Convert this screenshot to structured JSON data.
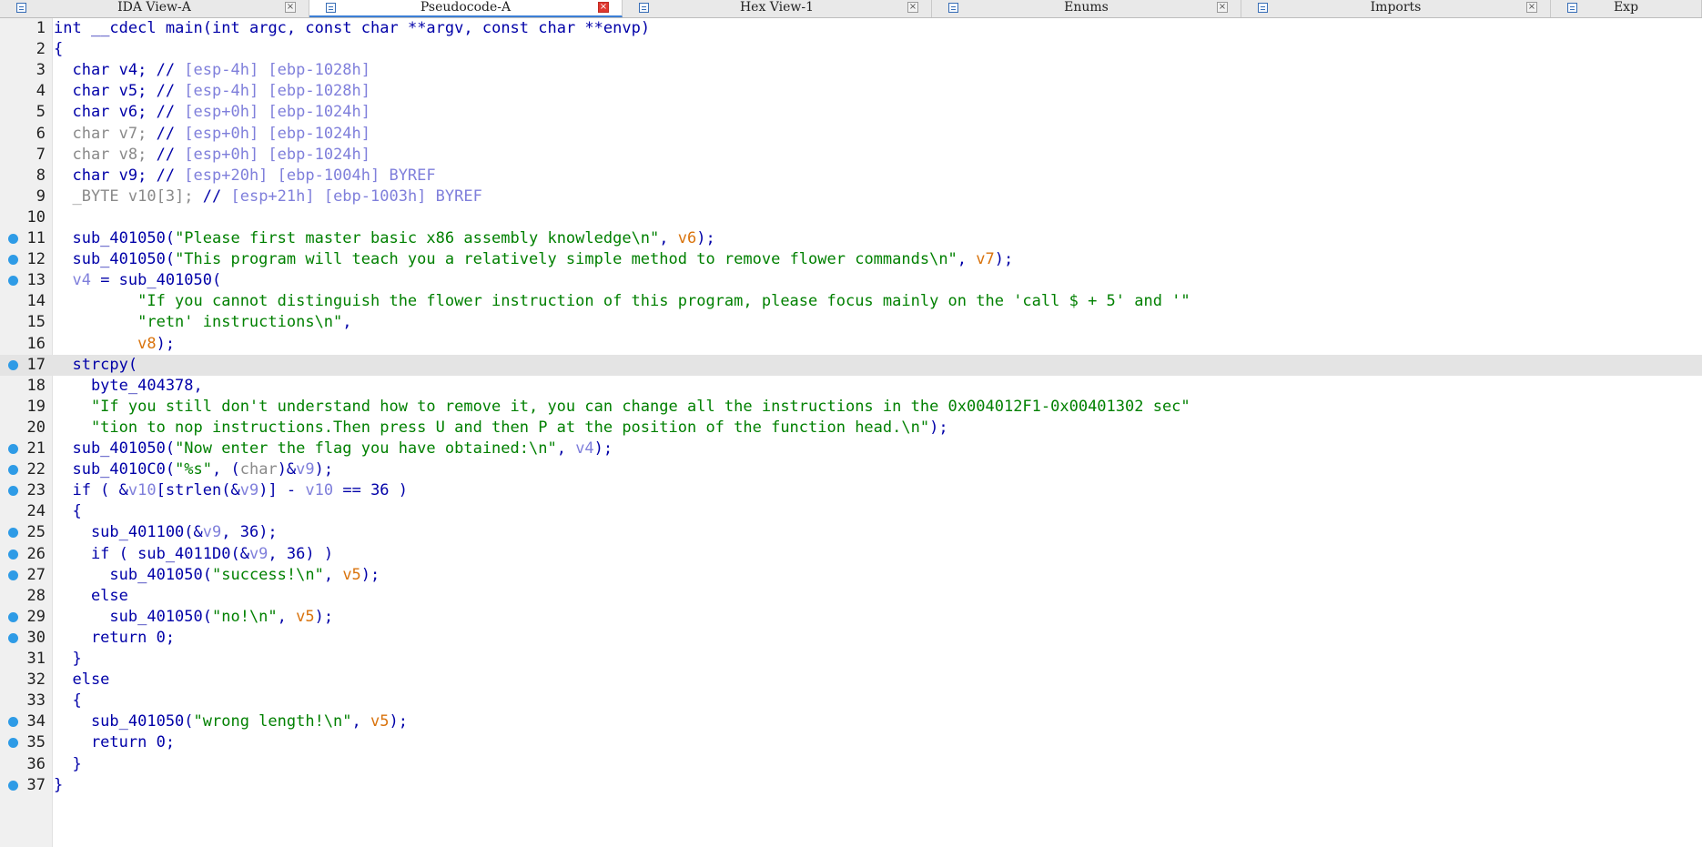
{
  "tabs": [
    {
      "label": "IDA View-A",
      "width": 340,
      "active": false,
      "close": "×"
    },
    {
      "label": "Pseudocode-A",
      "width": 344,
      "active": true,
      "close": "×"
    },
    {
      "label": "Hex View-1",
      "width": 340,
      "active": false,
      "close": "×"
    },
    {
      "label": "Enums",
      "width": 340,
      "active": false,
      "close": "×"
    },
    {
      "label": "Imports",
      "width": 340,
      "active": false,
      "close": "×"
    },
    {
      "label": "Exp",
      "width": 166,
      "active": false,
      "close": ""
    }
  ],
  "code": [
    {
      "n": "1",
      "bp": false,
      "hl": false,
      "segs": [
        [
          "kw",
          "int "
        ],
        [
          "kw",
          "__cdecl "
        ],
        [
          "fn",
          "main"
        ],
        [
          "kw",
          "(int argc, const char **argv, const char **envp)"
        ]
      ]
    },
    {
      "n": "2",
      "bp": false,
      "hl": false,
      "segs": [
        [
          "kw",
          "{"
        ]
      ]
    },
    {
      "n": "3",
      "bp": false,
      "hl": false,
      "segs": [
        [
          "kw",
          "  char v4; // "
        ],
        [
          "cm",
          "[esp-4h] [ebp-1028h]"
        ]
      ]
    },
    {
      "n": "4",
      "bp": false,
      "hl": false,
      "segs": [
        [
          "kw",
          "  char v5; // "
        ],
        [
          "cm",
          "[esp-4h] [ebp-1028h]"
        ]
      ]
    },
    {
      "n": "5",
      "bp": false,
      "hl": false,
      "segs": [
        [
          "kw",
          "  char v6; // "
        ],
        [
          "cm",
          "[esp+0h] [ebp-1024h]"
        ]
      ]
    },
    {
      "n": "6",
      "bp": false,
      "hl": false,
      "segs": [
        [
          "unk",
          "  char v7; "
        ],
        [
          "kw",
          "// "
        ],
        [
          "cm",
          "[esp+0h] [ebp-1024h]"
        ]
      ]
    },
    {
      "n": "7",
      "bp": false,
      "hl": false,
      "segs": [
        [
          "unk",
          "  char v8; "
        ],
        [
          "kw",
          "// "
        ],
        [
          "cm",
          "[esp+0h] [ebp-1024h]"
        ]
      ]
    },
    {
      "n": "8",
      "bp": false,
      "hl": false,
      "segs": [
        [
          "kw",
          "  char v9; // "
        ],
        [
          "cm",
          "[esp+20h] [ebp-1004h] BYREF"
        ]
      ]
    },
    {
      "n": "9",
      "bp": false,
      "hl": false,
      "segs": [
        [
          "unk",
          "  _BYTE v10[3]; "
        ],
        [
          "kw",
          "// "
        ],
        [
          "cm",
          "[esp+21h] [ebp-1003h] BYREF"
        ]
      ]
    },
    {
      "n": "10",
      "bp": false,
      "hl": false,
      "segs": []
    },
    {
      "n": "11",
      "bp": true,
      "hl": false,
      "segs": [
        [
          "kw",
          "  sub_401050("
        ],
        [
          "str",
          "\"Please first master basic x86 assembly knowledge\\n\""
        ],
        [
          "kw",
          ", "
        ],
        [
          "arg",
          "v6"
        ],
        [
          "kw",
          ");"
        ]
      ]
    },
    {
      "n": "12",
      "bp": true,
      "hl": false,
      "segs": [
        [
          "kw",
          "  sub_401050("
        ],
        [
          "str",
          "\"This program will teach you a relatively simple method to remove flower commands\\n\""
        ],
        [
          "kw",
          ", "
        ],
        [
          "arg",
          "v7"
        ],
        [
          "kw",
          ");"
        ]
      ]
    },
    {
      "n": "13",
      "bp": true,
      "hl": false,
      "segs": [
        [
          "var",
          "  v4"
        ],
        [
          "kw",
          " = sub_401050("
        ]
      ]
    },
    {
      "n": "14",
      "bp": false,
      "hl": false,
      "segs": [
        [
          "str",
          "         \"If you cannot distinguish the flower instruction of this program, please focus mainly on the 'call $ + 5' and '\""
        ]
      ]
    },
    {
      "n": "15",
      "bp": false,
      "hl": false,
      "segs": [
        [
          "str",
          "         \"retn' instructions\\n\""
        ],
        [
          "kw",
          ","
        ]
      ]
    },
    {
      "n": "16",
      "bp": false,
      "hl": false,
      "segs": [
        [
          "arg",
          "         v8"
        ],
        [
          "kw",
          ");"
        ]
      ]
    },
    {
      "n": "17",
      "bp": true,
      "hl": true,
      "segs": [
        [
          "kw",
          "  strcpy("
        ]
      ]
    },
    {
      "n": "18",
      "bp": false,
      "hl": false,
      "segs": [
        [
          "kw",
          "    byte_404378,"
        ]
      ]
    },
    {
      "n": "19",
      "bp": false,
      "hl": false,
      "segs": [
        [
          "str",
          "    \"If you still don't understand how to remove it, you can change all the instructions in the 0x004012F1-0x00401302 sec\""
        ]
      ]
    },
    {
      "n": "20",
      "bp": false,
      "hl": false,
      "segs": [
        [
          "str",
          "    \"tion to nop instructions.Then press U and then P at the position of the function head.\\n\""
        ],
        [
          "kw",
          ");"
        ]
      ]
    },
    {
      "n": "21",
      "bp": true,
      "hl": false,
      "segs": [
        [
          "kw",
          "  sub_401050("
        ],
        [
          "str",
          "\"Now enter the flag you have obtained:\\n\""
        ],
        [
          "kw",
          ", "
        ],
        [
          "var",
          "v4"
        ],
        [
          "kw",
          ");"
        ]
      ]
    },
    {
      "n": "22",
      "bp": true,
      "hl": false,
      "segs": [
        [
          "kw",
          "  sub_4010C0("
        ],
        [
          "str",
          "\"%s\""
        ],
        [
          "kw",
          ", ("
        ],
        [
          "unk",
          "char"
        ],
        [
          "kw",
          ")&"
        ],
        [
          "var",
          "v9"
        ],
        [
          "kw",
          ");"
        ]
      ]
    },
    {
      "n": "23",
      "bp": true,
      "hl": false,
      "segs": [
        [
          "kw",
          "  if ( &"
        ],
        [
          "var",
          "v10"
        ],
        [
          "kw",
          "[strlen(&"
        ],
        [
          "var",
          "v9"
        ],
        [
          "kw",
          ")] - "
        ],
        [
          "var",
          "v10"
        ],
        [
          "kw",
          " == 36 )"
        ]
      ]
    },
    {
      "n": "24",
      "bp": false,
      "hl": false,
      "segs": [
        [
          "kw",
          "  {"
        ]
      ]
    },
    {
      "n": "25",
      "bp": true,
      "hl": false,
      "segs": [
        [
          "kw",
          "    sub_401100(&"
        ],
        [
          "var",
          "v9"
        ],
        [
          "kw",
          ", 36);"
        ]
      ]
    },
    {
      "n": "26",
      "bp": true,
      "hl": false,
      "segs": [
        [
          "kw",
          "    if ( sub_4011D0(&"
        ],
        [
          "var",
          "v9"
        ],
        [
          "kw",
          ", 36) )"
        ]
      ]
    },
    {
      "n": "27",
      "bp": true,
      "hl": false,
      "segs": [
        [
          "kw",
          "      sub_401050("
        ],
        [
          "str",
          "\"success!\\n\""
        ],
        [
          "kw",
          ", "
        ],
        [
          "arg",
          "v5"
        ],
        [
          "kw",
          ");"
        ]
      ]
    },
    {
      "n": "28",
      "bp": false,
      "hl": false,
      "segs": [
        [
          "kw",
          "    else"
        ]
      ]
    },
    {
      "n": "29",
      "bp": true,
      "hl": false,
      "segs": [
        [
          "kw",
          "      sub_401050("
        ],
        [
          "str",
          "\"no!\\n\""
        ],
        [
          "kw",
          ", "
        ],
        [
          "arg",
          "v5"
        ],
        [
          "kw",
          ");"
        ]
      ]
    },
    {
      "n": "30",
      "bp": true,
      "hl": false,
      "segs": [
        [
          "kw",
          "    return 0;"
        ]
      ]
    },
    {
      "n": "31",
      "bp": false,
      "hl": false,
      "segs": [
        [
          "kw",
          "  }"
        ]
      ]
    },
    {
      "n": "32",
      "bp": false,
      "hl": false,
      "segs": [
        [
          "kw",
          "  else"
        ]
      ]
    },
    {
      "n": "33",
      "bp": false,
      "hl": false,
      "segs": [
        [
          "kw",
          "  {"
        ]
      ]
    },
    {
      "n": "34",
      "bp": true,
      "hl": false,
      "segs": [
        [
          "kw",
          "    sub_401050("
        ],
        [
          "str",
          "\"wrong length!\\n\""
        ],
        [
          "kw",
          ", "
        ],
        [
          "arg",
          "v5"
        ],
        [
          "kw",
          ");"
        ]
      ]
    },
    {
      "n": "35",
      "bp": true,
      "hl": false,
      "segs": [
        [
          "kw",
          "    return 0;"
        ]
      ]
    },
    {
      "n": "36",
      "bp": false,
      "hl": false,
      "segs": [
        [
          "kw",
          "  }"
        ]
      ]
    },
    {
      "n": "37",
      "bp": true,
      "hl": false,
      "segs": [
        [
          "kw",
          "}"
        ]
      ]
    }
  ]
}
